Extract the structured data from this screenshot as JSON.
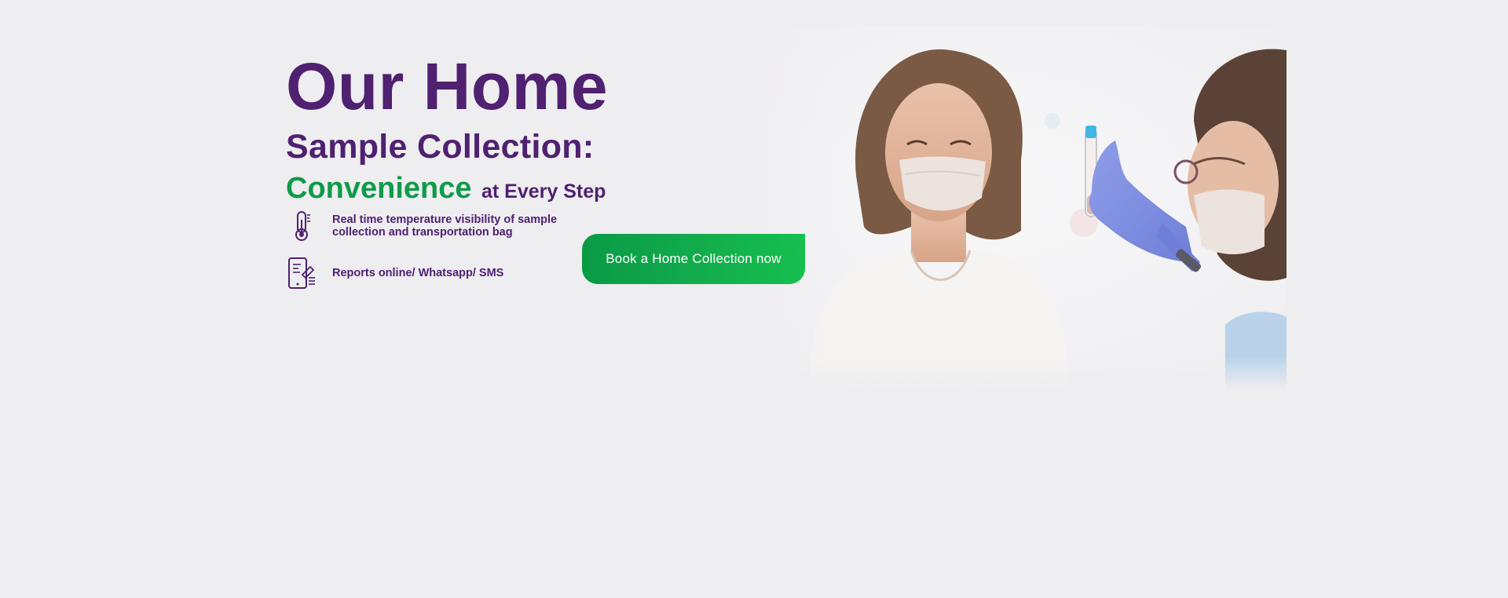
{
  "hero": {
    "headline_line1": "Our Home",
    "headline_line2": "Sample Collection:",
    "headline_accent": "Convenience",
    "headline_rest": "at Every Step",
    "photo_icon": "woman-and-lab-technician-photo"
  },
  "features": [
    {
      "icon": "thermometer-icon",
      "text": "Real time temperature visibility of sample\ncollection and transportation bag"
    },
    {
      "icon": "mobile-report-icon",
      "text": "Reports online/ Whatsapp/ SMS"
    }
  ],
  "cta": {
    "label": "Book a Home Collection now"
  },
  "colors": {
    "purple": "#4f2170",
    "green": "#0f9b48",
    "background": "#eeedf0"
  }
}
